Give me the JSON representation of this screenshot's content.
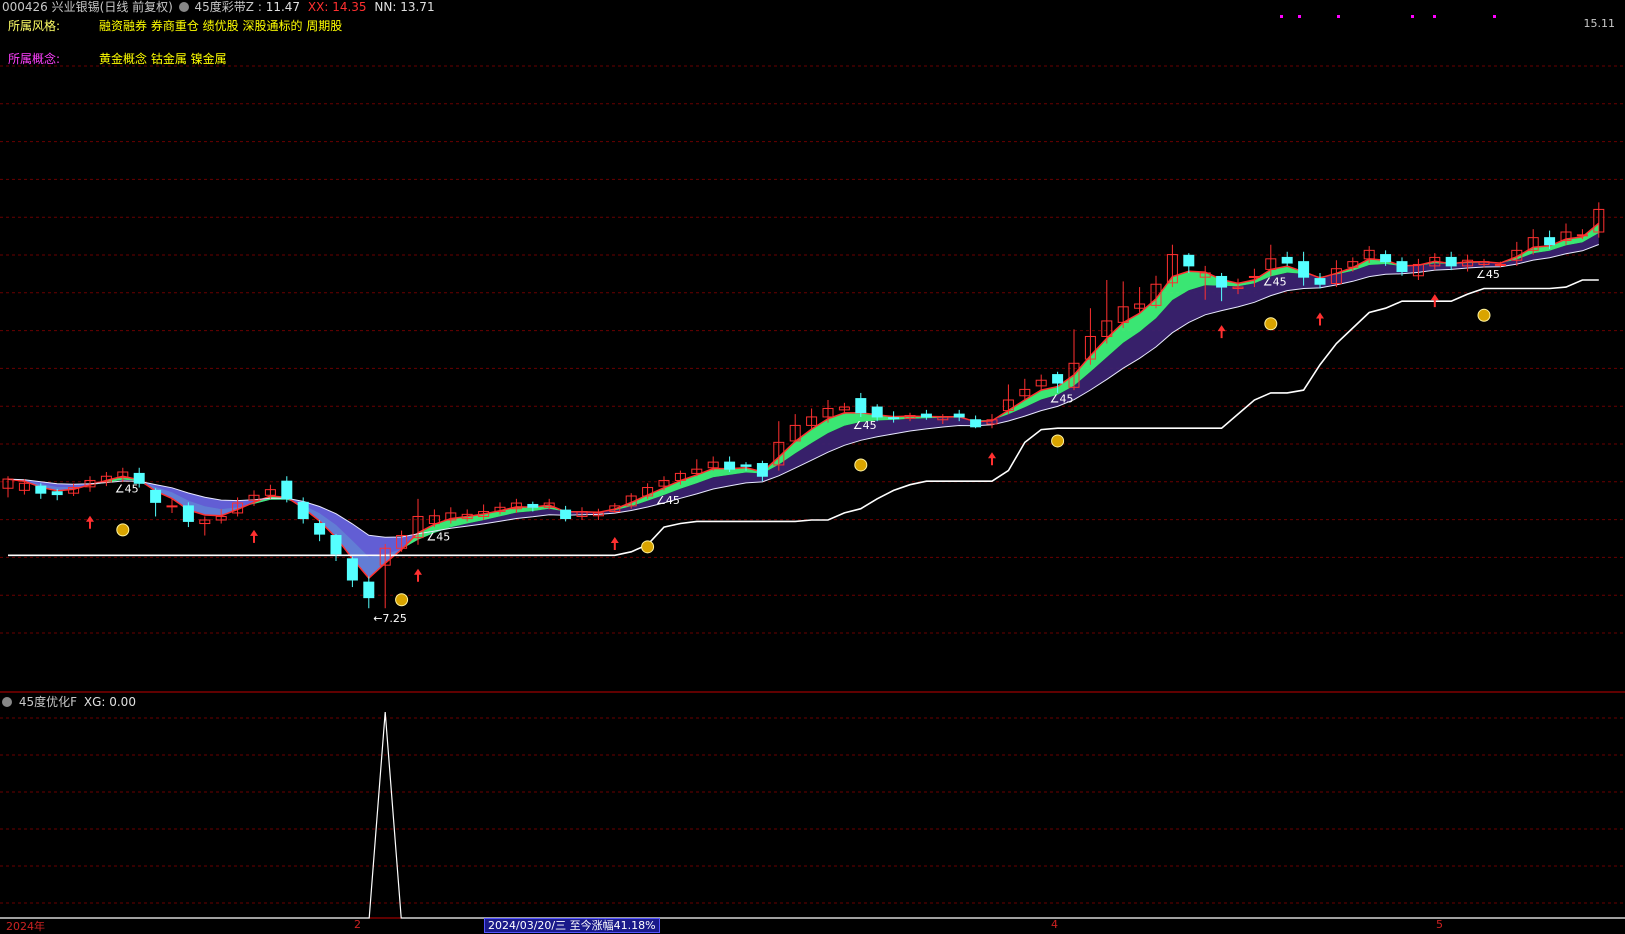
{
  "header": {
    "code": "000426",
    "name": "兴业银锡",
    "period": "(日线 前复权)",
    "indicator": "45度彩带Z",
    "z_value": "11.47",
    "xx_label": "XX:",
    "xx_value": "14.35",
    "nn_label": "NN:",
    "nn_value": "13.71",
    "price_top": "15.11"
  },
  "info": {
    "style_label": "所属风格:",
    "style_text": "融资融券 券商重仓 绩优股 深股通标的 周期股",
    "concept_label": "所属概念:",
    "concept_text": "黄金概念 钴金属 镍金属"
  },
  "lower_panel": {
    "indicator": "45度优化F",
    "xg_label": "XG:",
    "xg_value": "0.00"
  },
  "footer": {
    "year": "2024年",
    "m2": "2",
    "tip": "2024/03/20/三 至今涨幅41.18%",
    "m4": "4",
    "m5": "5"
  },
  "annotations": {
    "angle_text": "∠45",
    "low_marker": "←7.25"
  },
  "colors": {
    "background": "#000000",
    "grid": "#6a0000",
    "separator": "#c00000",
    "up": "#ff3030",
    "down": "#55ffff",
    "yellow": "#ffff00",
    "magenta": "#ff00ff",
    "band_green": "#40ff80",
    "band_purple": "#3a2270",
    "band_blue": "#6a6ae6",
    "support_line": "#ffffff"
  },
  "chart_data": {
    "type": "candlestick",
    "title": "000426 兴业银锡 (日线 前复权)",
    "y_top_label": 15.11,
    "lowest_price": 7.25,
    "ylim": [
      6.8,
      15.3
    ],
    "candles": [
      [
        8.95,
        9.08,
        8.82,
        9.12
      ],
      [
        8.92,
        9.02,
        8.86,
        9.08
      ],
      [
        8.98,
        8.88,
        8.8,
        9.02
      ],
      [
        8.9,
        8.86,
        8.78,
        8.94
      ],
      [
        8.88,
        8.96,
        8.84,
        9.02
      ],
      [
        8.97,
        9.06,
        8.9,
        9.12
      ],
      [
        9.04,
        9.12,
        8.98,
        9.18
      ],
      [
        9.1,
        9.18,
        9.04,
        9.24
      ],
      [
        9.16,
        9.02,
        8.96,
        9.24
      ],
      [
        8.92,
        8.75,
        8.55,
        8.95
      ],
      [
        8.7,
        8.7,
        8.6,
        8.8
      ],
      [
        8.7,
        8.48,
        8.4,
        8.75
      ],
      [
        8.45,
        8.5,
        8.28,
        8.55
      ],
      [
        8.5,
        8.55,
        8.45,
        8.65
      ],
      [
        8.6,
        8.74,
        8.55,
        8.82
      ],
      [
        8.78,
        8.85,
        8.7,
        8.92
      ],
      [
        8.85,
        8.93,
        8.8,
        9.0
      ],
      [
        9.05,
        8.8,
        8.75,
        9.12
      ],
      [
        8.75,
        8.52,
        8.45,
        8.82
      ],
      [
        8.45,
        8.3,
        8.2,
        8.5
      ],
      [
        8.28,
        8.02,
        7.92,
        8.3
      ],
      [
        7.95,
        7.65,
        7.55,
        7.98
      ],
      [
        7.62,
        7.4,
        7.25,
        7.7
      ],
      [
        7.86,
        8.1,
        7.25,
        8.16
      ],
      [
        8.1,
        8.28,
        8.05,
        8.35
      ],
      [
        8.25,
        8.55,
        8.15,
        8.8
      ],
      [
        8.45,
        8.56,
        8.4,
        8.65
      ],
      [
        8.5,
        8.6,
        8.45,
        8.68
      ],
      [
        8.52,
        8.58,
        8.48,
        8.65
      ],
      [
        8.55,
        8.62,
        8.5,
        8.72
      ],
      [
        8.62,
        8.68,
        8.58,
        8.75
      ],
      [
        8.66,
        8.74,
        8.6,
        8.8
      ],
      [
        8.72,
        8.68,
        8.62,
        8.76
      ],
      [
        8.68,
        8.74,
        8.65,
        8.8
      ],
      [
        8.64,
        8.52,
        8.48,
        8.7
      ],
      [
        8.55,
        8.62,
        8.5,
        8.68
      ],
      [
        8.56,
        8.6,
        8.5,
        8.66
      ],
      [
        8.62,
        8.7,
        8.6,
        8.74
      ],
      [
        8.7,
        8.84,
        8.66,
        8.88
      ],
      [
        8.84,
        8.96,
        8.8,
        9.02
      ],
      [
        8.98,
        9.06,
        8.92,
        9.12
      ],
      [
        9.06,
        9.16,
        9.0,
        9.2
      ],
      [
        9.16,
        9.22,
        9.12,
        9.36
      ],
      [
        9.24,
        9.32,
        9.2,
        9.4
      ],
      [
        9.32,
        9.22,
        9.18,
        9.4
      ],
      [
        9.28,
        9.26,
        9.2,
        9.32
      ],
      [
        9.3,
        9.12,
        9.05,
        9.34
      ],
      [
        9.28,
        9.6,
        9.2,
        9.9
      ],
      [
        9.62,
        9.84,
        9.6,
        10.0
      ],
      [
        9.84,
        9.96,
        9.78,
        10.08
      ],
      [
        9.96,
        10.08,
        9.88,
        10.2
      ],
      [
        10.06,
        10.1,
        10.0,
        10.16
      ],
      [
        10.22,
        10.02,
        9.96,
        10.3
      ],
      [
        10.1,
        9.96,
        9.9,
        10.14
      ],
      [
        9.95,
        9.94,
        9.88,
        10.04
      ],
      [
        9.94,
        9.98,
        9.9,
        10.02
      ],
      [
        10.0,
        9.96,
        9.92,
        10.06
      ],
      [
        9.92,
        9.96,
        9.86,
        10.0
      ],
      [
        10.0,
        9.96,
        9.9,
        10.06
      ],
      [
        9.92,
        9.82,
        9.8,
        9.98
      ],
      [
        9.86,
        9.92,
        9.8,
        10.0
      ],
      [
        10.05,
        10.2,
        10.0,
        10.42
      ],
      [
        10.26,
        10.35,
        10.2,
        10.5
      ],
      [
        10.4,
        10.48,
        10.34,
        10.56
      ],
      [
        10.56,
        10.44,
        10.3,
        10.6
      ],
      [
        10.38,
        10.72,
        10.34,
        11.2
      ],
      [
        10.78,
        11.1,
        10.7,
        11.5
      ],
      [
        11.1,
        11.32,
        11.0,
        11.9
      ],
      [
        11.3,
        11.52,
        11.22,
        11.88
      ],
      [
        11.5,
        11.56,
        11.44,
        11.8
      ],
      [
        11.54,
        11.84,
        11.5,
        11.96
      ],
      [
        11.86,
        12.26,
        11.8,
        12.4
      ],
      [
        12.25,
        12.1,
        12.0,
        12.28
      ],
      [
        11.94,
        12.0,
        11.62,
        12.1
      ],
      [
        11.95,
        11.8,
        11.6,
        12.0
      ],
      [
        11.78,
        11.8,
        11.7,
        11.92
      ],
      [
        11.95,
        11.95,
        11.8,
        12.06
      ],
      [
        12.05,
        12.2,
        11.96,
        12.4
      ],
      [
        12.22,
        12.14,
        12.1,
        12.3
      ],
      [
        12.16,
        11.94,
        11.82,
        12.3
      ],
      [
        11.92,
        11.84,
        11.78,
        12.0
      ],
      [
        11.85,
        12.06,
        11.8,
        12.18
      ],
      [
        12.08,
        12.16,
        12.02,
        12.22
      ],
      [
        12.2,
        12.32,
        12.14,
        12.38
      ],
      [
        12.26,
        12.16,
        12.1,
        12.32
      ],
      [
        12.16,
        12.02,
        11.96,
        12.22
      ],
      [
        11.96,
        12.12,
        11.9,
        12.2
      ],
      [
        12.1,
        12.22,
        12.04,
        12.28
      ],
      [
        12.22,
        12.1,
        12.04,
        12.3
      ],
      [
        12.1,
        12.18,
        12.02,
        12.26
      ],
      [
        12.12,
        12.16,
        12.08,
        12.2
      ],
      [
        12.12,
        12.12,
        12.08,
        12.16
      ],
      [
        12.18,
        12.32,
        12.1,
        12.44
      ],
      [
        12.32,
        12.5,
        12.26,
        12.62
      ],
      [
        12.5,
        12.4,
        12.34,
        12.6
      ],
      [
        12.46,
        12.58,
        12.4,
        12.7
      ],
      [
        12.54,
        12.54,
        12.48,
        12.62
      ],
      [
        12.58,
        12.9,
        12.5,
        13.0
      ]
    ]
  }
}
